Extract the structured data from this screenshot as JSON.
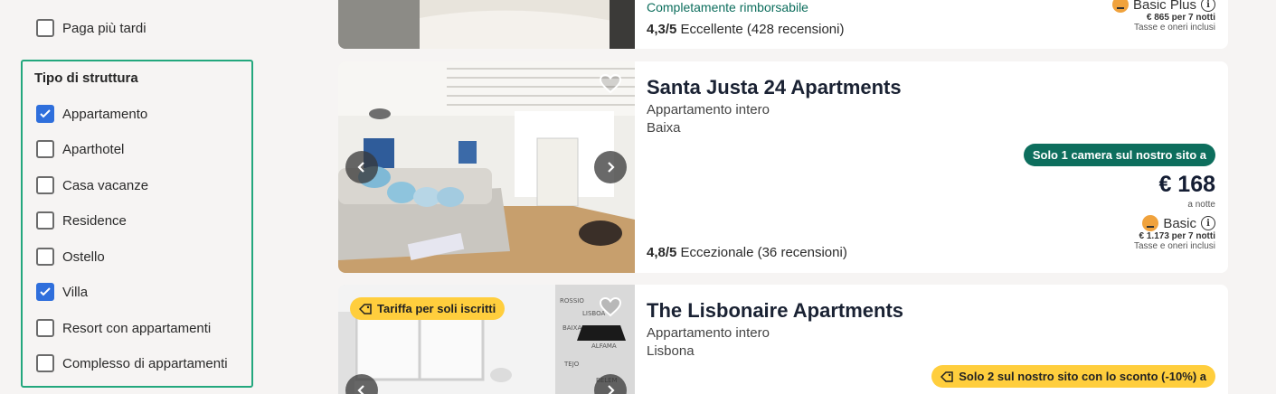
{
  "sidebar": {
    "pay_later": {
      "label": "Paga più tardi",
      "checked": false
    },
    "property_type": {
      "title": "Tipo di struttura",
      "items": [
        {
          "label": "Appartamento",
          "checked": true
        },
        {
          "label": "Aparthotel",
          "checked": false
        },
        {
          "label": "Casa vacanze",
          "checked": false
        },
        {
          "label": "Residence",
          "checked": false
        },
        {
          "label": "Ostello",
          "checked": false
        },
        {
          "label": "Villa",
          "checked": true
        },
        {
          "label": "Resort con appartamenti",
          "checked": false
        },
        {
          "label": "Complesso di appartamenti",
          "checked": false
        }
      ]
    }
  },
  "card0": {
    "refund": "Completamente rimborsabile",
    "rating_score": "4,3/5",
    "rating_text": "Eccellente (428 recensioni)",
    "plan": "Basic Plus",
    "total": "€ 865 per 7 notti",
    "taxes": "Tasse e oneri inclusi"
  },
  "card1": {
    "name": "Santa Justa 24 Apartments",
    "type": "Appartamento intero",
    "area": "Baixa",
    "badge": "Solo 1 camera sul nostro sito a",
    "price": "€ 168",
    "per_night": "a notte",
    "plan": "Basic",
    "total": "€ 1.173 per 7 notti",
    "taxes": "Tasse e oneri inclusi",
    "rating_score": "4,8/5",
    "rating_text": "Eccezionale (36 recensioni)"
  },
  "card2": {
    "tag": "Tariffa per soli iscritti",
    "name": "The Lisbonaire Apartments",
    "type": "Appartamento intero",
    "area": "Lisbona",
    "badge": "Solo 2 sul nostro sito con lo sconto (-10%) a"
  },
  "colors": {
    "accent_blue": "#2f6fdc",
    "filter_border": "#23a77d",
    "badge_green": "#0d6e5d",
    "badge_yellow": "#ffce3d"
  }
}
